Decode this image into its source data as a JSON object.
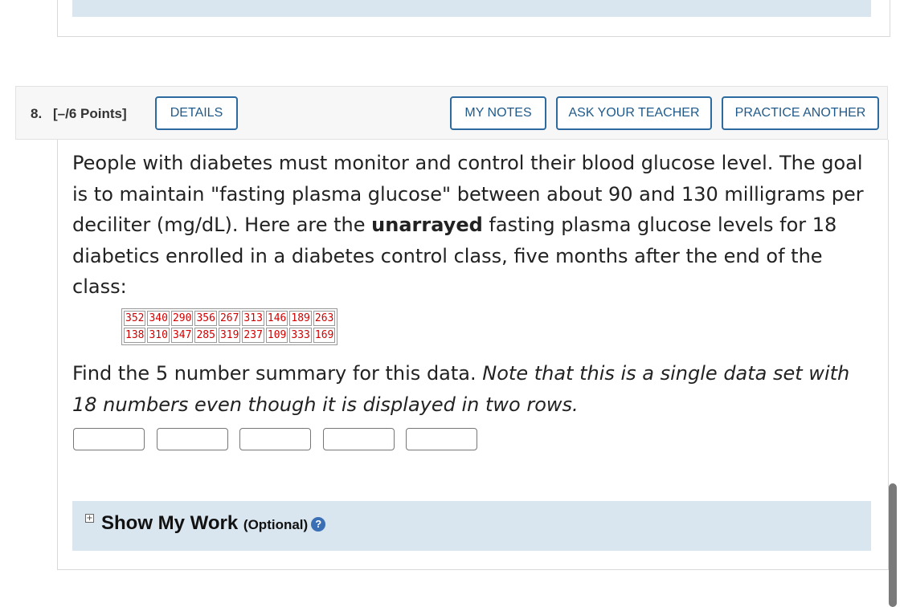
{
  "previous": {
    "work_title": "Show My Work",
    "work_optional": "(Optional)"
  },
  "question": {
    "number": "8.",
    "points": "[–/6 Points]",
    "buttons": {
      "details": "DETAILS",
      "my_notes": "MY NOTES",
      "ask_teacher": "ASK YOUR TEACHER",
      "practice": "PRACTICE ANOTHER"
    },
    "text_before": "People with diabetes must monitor and control their blood glucose level. The goal is to maintain \"fasting plasma glucose\" between about 90 and 130 milligrams per deciliter (mg/dL). Here are the ",
    "text_bold": "unarrayed",
    "text_after": " fasting plasma glucose levels for 18 diabetics enrolled in a diabetes control class, five months after the end of the class:",
    "data_rows": [
      [
        "352",
        "340",
        "290",
        "356",
        "267",
        "313",
        "146",
        "189",
        "263"
      ],
      [
        "138",
        "310",
        "347",
        "285",
        "319",
        "237",
        "109",
        "333",
        "169"
      ]
    ],
    "find_plain": "Find the 5 number summary for this data. ",
    "find_italic": "Note that this is a single data set with 18 numbers even though it is displayed in two rows.",
    "answers": [
      "",
      "",
      "",
      "",
      ""
    ],
    "work_title": "Show My Work",
    "work_optional": "(Optional)",
    "help_glyph": "?",
    "plus_glyph": "+"
  }
}
